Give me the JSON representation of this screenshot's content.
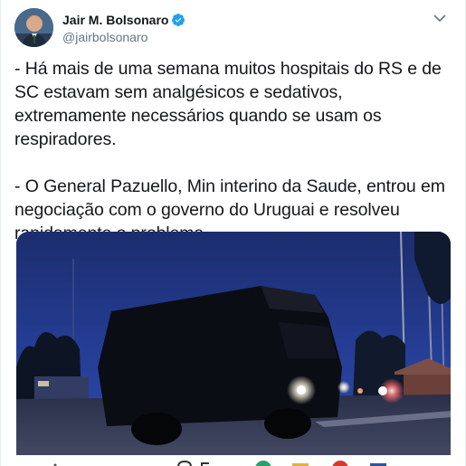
{
  "author": {
    "display_name": "Jair M. Bolsonaro",
    "handle": "@jairbolsonaro",
    "verified": true,
    "avatar_icon": "profile-photo"
  },
  "tweet": {
    "paragraphs": [
      "- Há mais de uma semana muitos hospitais do RS e de SC estavam sem analgésicos e sedativos, extremamente necessários quando se usam os respiradores.",
      "- O General Pazuello, Min interino da Saude, entrou em negociação com o governo do Uruguai e resolveu rapidamente o problema."
    ]
  },
  "media": {
    "type": "video-thumbnail",
    "description_icon": "military-truck-night-scene"
  },
  "icons": {
    "verified": "verified-badge-icon",
    "more": "chevron-down-icon"
  },
  "colors": {
    "text_primary": "#14171a",
    "text_secondary": "#657786",
    "verified_blue": "#1da1f2",
    "media_sky": "#233a8a"
  }
}
